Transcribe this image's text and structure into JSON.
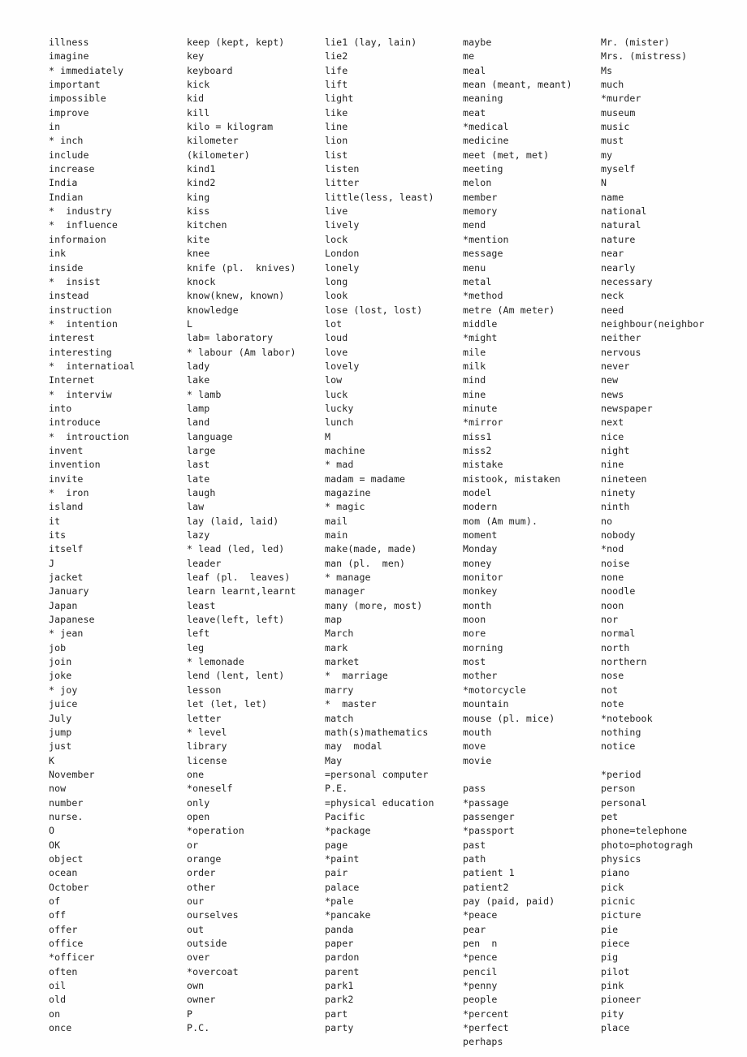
{
  "document": {
    "type": "vocabulary-word-list",
    "page_background": "#fefefe",
    "text_color": "#222222",
    "column_count": 5,
    "note": "Scanned vocabulary reference list, alphabetical, asterisk marks starred entries"
  },
  "columns": [
    {
      "id": "column-1",
      "entries": [
        "illness",
        "imagine",
        "* immediately",
        "important",
        "impossible",
        "improve",
        "in",
        "* inch",
        "include",
        "increase",
        "India",
        "Indian",
        "*  industry",
        "*  influence",
        "informaion",
        "ink",
        "inside",
        "*  insist",
        "instead",
        "instruction",
        "*  intention",
        "interest",
        "interesting",
        "*  internatioal",
        "Internet",
        "*  interviw",
        "into",
        "introduce",
        "*  introuction",
        "invent",
        "invention",
        "invite",
        "*  iron",
        "island",
        "it",
        "its",
        "itself",
        "J",
        "jacket",
        "January",
        "Japan",
        "Japanese",
        "* jean",
        "job",
        "join",
        "joke",
        "* joy",
        "juice",
        "July",
        "jump",
        "just",
        "K",
        "November",
        "now",
        "number",
        "nurse.",
        "O",
        "OK",
        "object",
        "ocean",
        "October",
        "of",
        "off",
        "offer",
        "office",
        "*officer",
        "often",
        "oil",
        "old",
        "on",
        "once"
      ]
    },
    {
      "id": "column-2",
      "entries": [
        "keep (kept, kept)",
        "key",
        "keyboard",
        "kick",
        "kid",
        "kill",
        "kilo = kilogram",
        "kilometer",
        "(kilometer)",
        "kind1",
        "kind2",
        "king",
        "kiss",
        "kitchen",
        "kite",
        "knee",
        "knife (pl.  knives)",
        "knock",
        "know(knew, known)",
        "knowledge",
        "L",
        "lab= laboratory",
        "* labour (Am labor)",
        "lady",
        "lake",
        "* lamb",
        "lamp",
        "land",
        "language",
        "large",
        "last",
        "late",
        "laugh",
        "law",
        "lay (laid, laid)",
        "lazy",
        "* lead (led, led)",
        "leader",
        "leaf (pl.  leaves)",
        "learn learnt,learnt",
        "least",
        "leave(left, left)",
        "left",
        "leg",
        "* lemonade",
        "lend (lent, lent)",
        "lesson",
        "let (let, let)",
        "letter",
        "* level",
        "library",
        "license",
        "one",
        "*oneself",
        "only",
        "open",
        "*operation",
        "or",
        "orange",
        "order",
        "other",
        "our",
        "ourselves",
        "out",
        "outside",
        "over",
        "*overcoat",
        "own",
        "owner",
        "P",
        "P.C."
      ]
    },
    {
      "id": "column-3",
      "entries": [
        "lie1 (lay, lain)",
        "lie2",
        "life",
        "lift",
        "light",
        "like",
        "line",
        "lion",
        "list",
        "listen",
        "litter",
        "little(less, least)",
        "live",
        "lively",
        "lock",
        "London",
        "lonely",
        "long",
        "look",
        "lose (lost, lost)",
        "lot",
        "loud",
        "love",
        "lovely",
        "low",
        "luck",
        "lucky",
        "lunch",
        "M",
        "machine",
        "* mad",
        "madam = madame",
        "magazine",
        "* magic",
        "mail",
        "main",
        "make(made, made)",
        "man (pl.  men)",
        "* manage",
        "manager",
        "many (more, most)",
        "map",
        "March",
        "mark",
        "market",
        "*  marriage",
        "marry",
        "*  master",
        "match",
        "math(s)mathematics",
        "may  modal",
        "May",
        "=personal computer",
        "P.E.",
        "=physical education",
        "Pacific",
        "*package",
        "page",
        "*paint",
        "pair",
        "palace",
        "*pale",
        "*pancake",
        "panda",
        "paper",
        "pardon",
        "parent",
        "park1",
        "park2",
        "part",
        "party"
      ]
    },
    {
      "id": "column-4",
      "entries": [
        "maybe",
        "me",
        "meal",
        "mean (meant, meant)",
        "meaning",
        "meat",
        "*medical",
        "medicine",
        "meet (met, met)",
        "meeting",
        "melon",
        "member",
        "memory",
        "mend",
        "*mention",
        "message",
        "menu",
        "metal",
        "*method",
        "metre (Am meter)",
        "middle",
        "*might",
        "mile",
        "milk",
        "mind",
        "mine",
        "minute",
        "*mirror",
        "miss1",
        "miss2",
        "mistake",
        "mistook, mistaken",
        "model",
        "modern",
        "mom (Am mum).",
        "moment",
        "Monday",
        "money",
        "monitor",
        "monkey",
        "month",
        "moon",
        "more",
        "morning",
        "most",
        "mother",
        "*motorcycle",
        "mountain",
        "mouse (pl. mice)",
        "mouth",
        "move",
        "movie",
        "",
        "pass",
        "*passage",
        "passenger",
        "*passport",
        "past",
        "path",
        "patient 1",
        "patient2",
        "pay (paid, paid)",
        "*peace",
        "pear",
        "pen  n",
        "*pence",
        "pencil",
        "*penny",
        "people",
        "*percent",
        "*perfect",
        "perhaps"
      ]
    },
    {
      "id": "column-5",
      "entries": [
        "Mr. (mister)",
        "Mrs. (mistress)",
        "Ms",
        "much",
        "*murder",
        "museum",
        "music",
        "must",
        "my",
        "myself",
        "N",
        "name",
        "national",
        "natural",
        "nature",
        "near",
        "nearly",
        "necessary",
        "neck",
        "need",
        "neighbour(neighbor",
        "neither",
        "nervous",
        "never",
        "new",
        "news",
        "newspaper",
        "next",
        "nice",
        "night",
        "nine",
        "nineteen",
        "ninety",
        "ninth",
        "no",
        "nobody",
        "*nod",
        "noise",
        "none",
        "noodle",
        "noon",
        "nor",
        "normal",
        "north",
        "northern",
        "nose",
        "not",
        "note",
        "*notebook",
        "nothing",
        "notice",
        "",
        "*period",
        "person",
        "personal",
        "pet",
        "phone=telephone",
        "photo=photogragh",
        "physics",
        "piano",
        "pick",
        "picnic",
        "picture",
        "pie",
        "piece",
        "pig",
        "pilot",
        "pink",
        "pioneer",
        "pity",
        "place"
      ]
    }
  ]
}
